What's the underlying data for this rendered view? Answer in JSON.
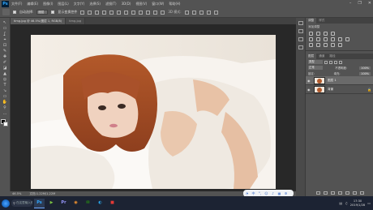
{
  "app": {
    "logo": "Ps"
  },
  "menu": [
    "文件(F)",
    "编辑(E)",
    "图像(I)",
    "图层(L)",
    "文字(Y)",
    "选择(S)",
    "滤镜(T)",
    "3D(D)",
    "视图(V)",
    "窗口(W)",
    "帮助(H)"
  ],
  "window_controls": [
    "minimize-icon",
    "restore-icon",
    "close-icon"
  ],
  "options": {
    "auto_select_label": "自动选择:",
    "auto_select_value": "图层",
    "show_transform_label": "显示变换控件",
    "mode_3d_label": "3D 模式:"
  },
  "document": {
    "tab_title": "timg.jpg @ 46.5%(图层 1, RGB/8)",
    "tab_extra": "timg.jpg"
  },
  "tools": [
    "↖",
    "▭",
    "ʆ",
    "⌖",
    "⊡",
    "✎",
    "✚",
    "✐",
    "◪",
    "▲",
    "◎",
    "T",
    "↘",
    "▭",
    "✋",
    "⚲",
    "…"
  ],
  "status": {
    "zoom": "46.5%",
    "doc_size": "文档:1.22M/1.22M"
  },
  "panels": {
    "top_tabs": [
      "调整",
      "样式"
    ],
    "adjust_title": "添加调整",
    "layer_tabs": [
      "图层",
      "通道",
      "路径"
    ],
    "kind_filter": "类型",
    "blend_mode": "正常",
    "opacity_label": "不透明度:",
    "opacity_value": "100%",
    "lock_label": "锁定:",
    "fill_label": "填充:",
    "fill_value": "100%",
    "layers": [
      {
        "name": "图层 1",
        "selected": true
      },
      {
        "name": "背景",
        "selected": false
      }
    ]
  },
  "ime": {
    "label": "中",
    "icons": [
      "mic-icon",
      "keyboard-icon",
      "settings-icon"
    ]
  },
  "taskbar": {
    "search_text": "在这里输入你要搜索的内容",
    "apps": [
      {
        "name": "photoshop-app",
        "glyph": "Ps",
        "color": "#31a8ff",
        "active": true
      },
      {
        "name": "media-app",
        "glyph": "▶",
        "color": "#7cc242",
        "active": false
      },
      {
        "name": "premiere-app",
        "glyph": "Pr",
        "color": "#9999ff",
        "active": false
      },
      {
        "name": "browser-app",
        "glyph": "◉",
        "color": "#ff9a2f",
        "active": false
      },
      {
        "name": "wechat-app",
        "glyph": "✉",
        "color": "#2dc100",
        "active": false
      },
      {
        "name": "qq-app",
        "glyph": "◐",
        "color": "#29a9ef",
        "active": false
      },
      {
        "name": "video-app",
        "glyph": "■",
        "color": "#e53935",
        "active": false
      }
    ],
    "time": "17:30",
    "date": "2019/1/28"
  }
}
